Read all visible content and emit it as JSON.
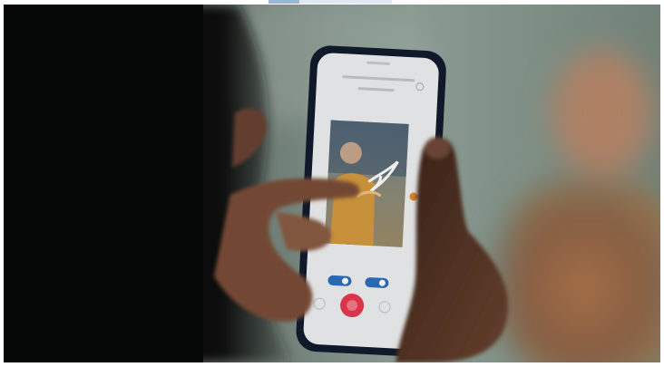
{
  "media": {
    "kind": "video-frame",
    "progress_fraction": 0.25
  },
  "colors": {
    "backdrop": "#6f7d73",
    "phone_frame": "#111b2d",
    "phone_screen": "#eef0f1",
    "record_button": "#e8384f",
    "toggle_blue": "#2e6fbe",
    "person_shirt": "#d49a3e",
    "skin_light": "#c08b6a",
    "skin_dark": "#5b3827"
  },
  "phone_ui": {
    "icons": [
      "record-button-icon",
      "toggle-left-icon",
      "toggle-right-icon",
      "drawn-swoosh-icon"
    ]
  }
}
